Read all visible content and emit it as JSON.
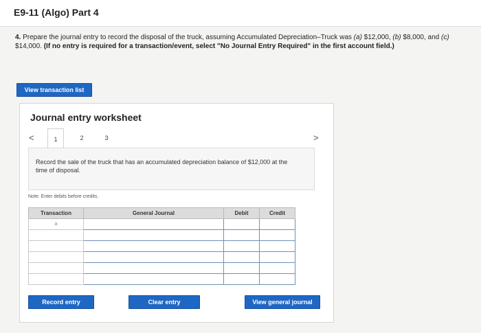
{
  "header": {
    "title": "E9-11 (Algo) Part 4"
  },
  "question": {
    "number": "4.",
    "text_part1": "Prepare the journal entry to record the disposal of the truck, assuming Accumulated Depreciation–Truck was ",
    "a_label": "(a)",
    "a_value": " $12,000, ",
    "b_label": "(b)",
    "b_value": "$8,000, and ",
    "c_label": "(c)",
    "c_value": "$14,000. ",
    "bold_note": "(If no entry is required for a transaction/event, select \"No Journal Entry Required\" in the first account field.)"
  },
  "buttons": {
    "view_transaction_list": "View transaction list",
    "record_entry": "Record entry",
    "clear_entry": "Clear entry",
    "view_general_journal": "View general journal"
  },
  "worksheet": {
    "title": "Journal entry worksheet",
    "nav_prev": "<",
    "nav_next": ">",
    "tabs": [
      {
        "label": "1"
      },
      {
        "label": "2"
      },
      {
        "label": "3"
      }
    ],
    "instruction": "Record the sale of the truck that has an accumulated depreciation balance of $12,000 at the time of disposal.",
    "note": "Note: Enter debits before credits."
  },
  "table": {
    "headers": {
      "transaction": "Transaction",
      "general_journal": "General Journal",
      "debit": "Debit",
      "credit": "Credit"
    },
    "first_transaction": "a"
  }
}
